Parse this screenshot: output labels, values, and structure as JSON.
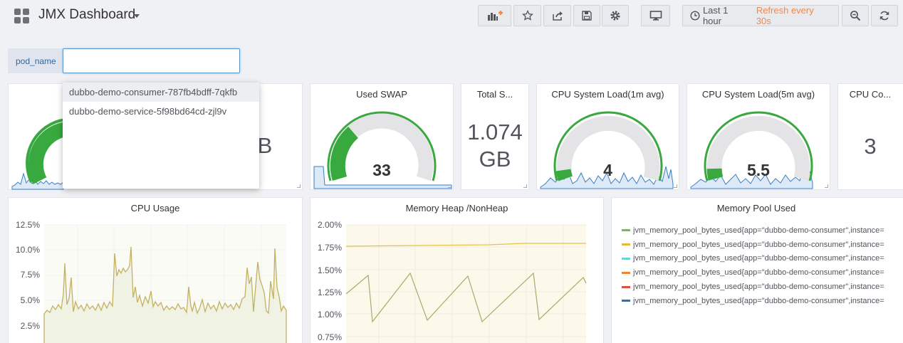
{
  "header": {
    "title": "JMX Dashboard",
    "time_range": "Last 1 hour",
    "refresh": "Refresh every 30s",
    "icons": [
      "add-panel-icon",
      "star-icon",
      "share-icon",
      "save-icon",
      "settings-icon",
      "tv-mode-icon",
      "clock-icon",
      "zoom-out-icon",
      "refresh-icon"
    ]
  },
  "variable": {
    "label": "pod_name",
    "value": "",
    "options": [
      "dubbo-demo-consumer-787fb4bdff-7qkfb",
      "dubbo-demo-service-5f98bd64cd-zjl9v"
    ]
  },
  "stats": [
    {
      "title": "",
      "value": "",
      "gauge": true
    },
    {
      "title": "",
      "value": "B"
    },
    {
      "title": "Used SWAP",
      "value": "33",
      "gauge": true
    },
    {
      "title": "Total S...",
      "value_line1": "1.074",
      "value_line2": "GB"
    },
    {
      "title": "CPU System Load(1m avg)",
      "value": "4",
      "gauge": true
    },
    {
      "title": "CPU System Load(5m avg)",
      "value": "5.5",
      "gauge": true
    },
    {
      "title": "CPU Co...",
      "value": "3"
    }
  ],
  "charts": {
    "cpu_usage": {
      "title": "CPU Usage",
      "y_ticks": [
        "12.5%",
        "10.0%",
        "7.5%",
        "5.0%",
        "2.5%"
      ]
    },
    "memory_heap": {
      "title": "Memory Heap /NonHeap",
      "y_ticks": [
        "2.00%",
        "1.75%",
        "1.50%",
        "1.25%",
        "1.00%",
        "0.75%"
      ]
    },
    "memory_pool": {
      "title": "Memory Pool Used",
      "legend": [
        {
          "label": "jvm_memory_pool_bytes_used{app=\"dubbo-demo-consumer\",instance=",
          "color": "#7eb26d"
        },
        {
          "label": "jvm_memory_pool_bytes_used{app=\"dubbo-demo-consumer\",instance=",
          "color": "#eab839"
        },
        {
          "label": "jvm_memory_pool_bytes_used{app=\"dubbo-demo-consumer\",instance=",
          "color": "#6ed0e0"
        },
        {
          "label": "jvm_memory_pool_bytes_used{app=\"dubbo-demo-consumer\",instance=",
          "color": "#ef843c"
        },
        {
          "label": "jvm_memory_pool_bytes_used{app=\"dubbo-demo-consumer\",instance=",
          "color": "#e24d42"
        },
        {
          "label": "jvm_memory_pool_bytes_used{app=\"dubbo-demo-consumer\",instance=",
          "color": "#1f78c1"
        }
      ]
    }
  },
  "colors": {
    "gauge_green": "#37a93e",
    "gauge_track": "#e4e4e6",
    "sparkline": "#3c7fc4",
    "cpu_line": "#c3b163",
    "heap_line": "#e5c24a",
    "nonheap_line": "#a9a96c"
  }
}
